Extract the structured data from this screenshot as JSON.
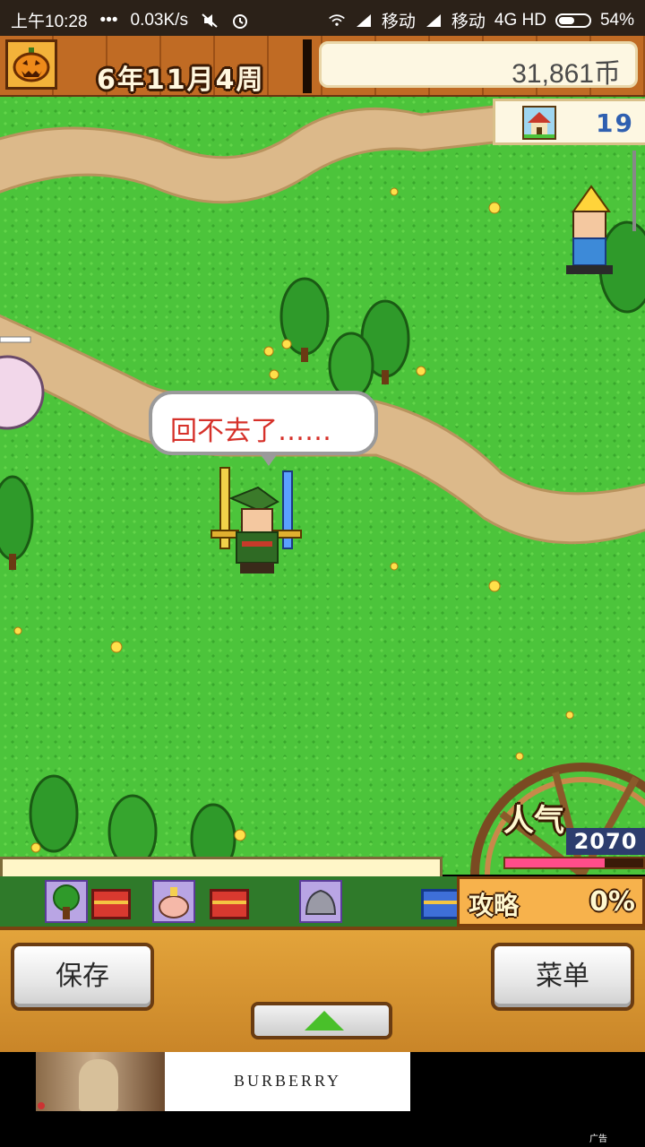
{
  "status_bar": {
    "time": "上午10:28",
    "dots": "•••",
    "speed": "0.03K/s",
    "carrier1": "移动",
    "carrier2": "移动",
    "network": "4G HD",
    "battery": "54%",
    "battery_level": 0.54,
    "icons": [
      "mute-icon",
      "alarm-icon",
      "wifi-icon",
      "signal-icon",
      "signal-icon",
      "battery-icon"
    ]
  },
  "top_bar": {
    "date": "6年11月4周",
    "money": "31,861币",
    "menu_icon": "pumpkin-icon"
  },
  "town_counter": {
    "icon": "house-icon",
    "value": "19"
  },
  "speech_bubble": {
    "text": "回不去了……"
  },
  "popularity": {
    "label": "人气",
    "value": "2070",
    "bar_fraction": 0.72
  },
  "guide": {
    "label": "攻略",
    "value": "0%"
  },
  "bottom_buttons": {
    "save": "保存",
    "menu": "菜单",
    "expand_icon": "up-arrow-icon"
  },
  "ad": {
    "brand": "BURBERRY",
    "tag": "广告"
  },
  "colors": {
    "grass": "#4cc43b",
    "path": "#dcb98a",
    "speech_text": "#d6312a",
    "popularity_bar": "#ff4d8a"
  }
}
